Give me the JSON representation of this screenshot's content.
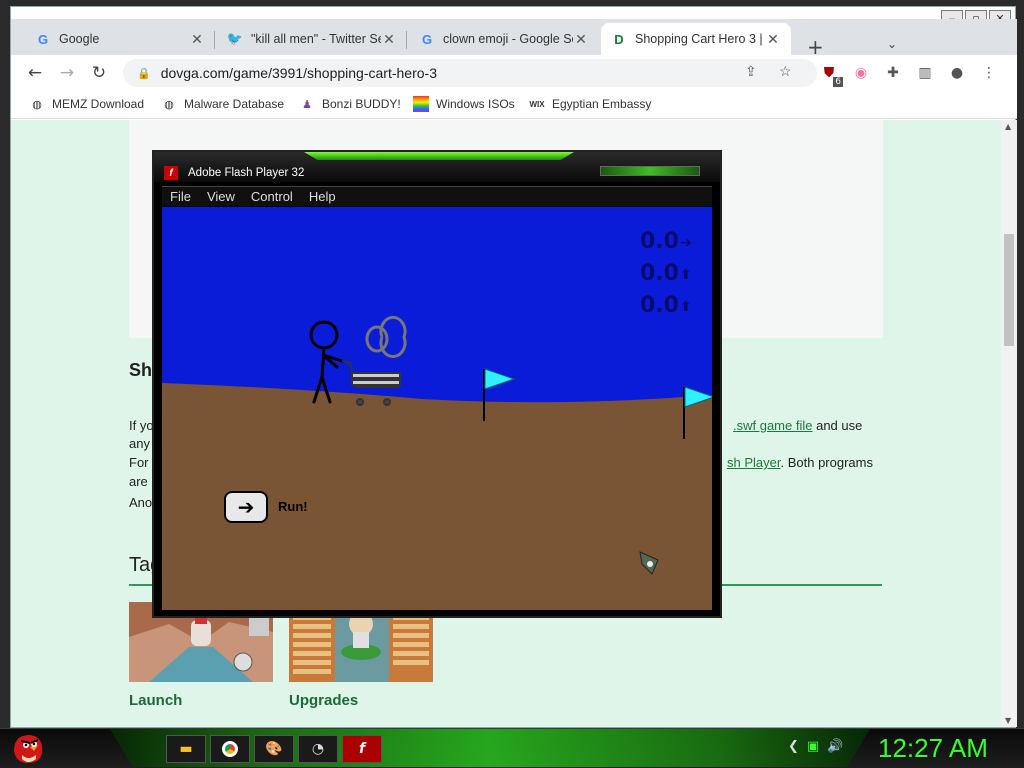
{
  "colors": {
    "accent_green": "#3cff30",
    "link": "#1a7a3a",
    "page_bg": "#dff5ea",
    "game_sky": "#0a1cd8",
    "game_ground": "#7a5535",
    "flag": "#2ef0ff"
  },
  "tabs": [
    {
      "title": "Google",
      "icon": "google-icon",
      "close": "✕"
    },
    {
      "title": "\"kill all men\" - Twitter Se",
      "icon": "twitter-icon",
      "close": "✕"
    },
    {
      "title": "clown emoji - Google Se",
      "icon": "google-icon",
      "close": "✕"
    },
    {
      "title": "Shopping Cart Hero 3 |",
      "icon": "dovga-icon",
      "close": "✕",
      "active": true
    }
  ],
  "toolbar": {
    "url": "dovga.com/game/3991/shopping-cart-hero-3",
    "ext_badge": "6"
  },
  "bookmarks": [
    {
      "label": "MEMZ Download",
      "icon": "globe-icon"
    },
    {
      "label": "Malware Database",
      "icon": "globe-icon"
    },
    {
      "label": "Bonzi BUDDY!",
      "icon": "bonzi-icon"
    },
    {
      "label": "Windows ISOs",
      "icon": "rainbow-icon"
    },
    {
      "label": "Egyptian Embassy",
      "icon": "wix-icon"
    }
  ],
  "page": {
    "title_fragment": "Sho",
    "p1_left": "If yo",
    "p1_right_link": ".swf game file",
    "p1_right_text": " and use",
    "p2_left": "any",
    "p3_left": "For",
    "p3_right_link": "sh Player",
    "p3_right_text": ". Both programs",
    "p4_left": "are",
    "p5_left": "Ano",
    "tags_heading": "Tag",
    "tiles": [
      {
        "label": "Launch"
      },
      {
        "label": "Upgrades"
      }
    ]
  },
  "flash": {
    "window_title": "Adobe Flash Player 32",
    "menu": [
      "File",
      "View",
      "Control",
      "Help"
    ],
    "scores": [
      {
        "value": "0.0",
        "arrow": "➔"
      },
      {
        "value": "0.0",
        "arrow": "⬆"
      },
      {
        "value": "0.0",
        "arrow": "⬆"
      }
    ],
    "run_label": "Run!",
    "run_arrow": "➔"
  },
  "taskbar": {
    "clock": "12:27 AM"
  }
}
